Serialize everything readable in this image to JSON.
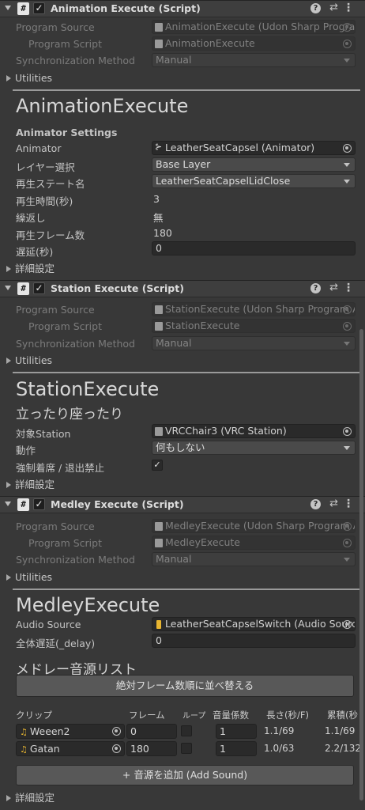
{
  "components": [
    {
      "title": "Animation Execute (Script)",
      "program_source_label": "Program Source",
      "program_source_value": "AnimationExecute (Udon Sharp Program Asset)",
      "program_script_label": "Program Script",
      "program_script_value": "AnimationExecute",
      "sync_label": "Synchronization Method",
      "sync_value": "Manual",
      "utilities": "Utilities",
      "heading": "AnimationExecute",
      "section": "Animator Settings",
      "animator_label": "Animator",
      "animator_value": "LeatherSeatCapsel (Animator)",
      "layer_label": "レイヤー選択",
      "layer_value": "Base Layer",
      "state_label": "再生ステート名",
      "state_value": "LeatherSeatCapselLidClose",
      "time_label": "再生時間(秒)",
      "time_value": "3",
      "loop_label": "繰返し",
      "loop_value": "無",
      "frames_label": "再生フレーム数",
      "frames_value": "180",
      "delay_label": "遅延(秒)",
      "delay_value": "0",
      "advanced": "詳細設定"
    },
    {
      "title": "Station Execute (Script)",
      "program_source_label": "Program Source",
      "program_source_value": "StationExecute (Udon Sharp Program Asset)",
      "program_script_label": "Program Script",
      "program_script_value": "StationExecute",
      "sync_label": "Synchronization Method",
      "sync_value": "Manual",
      "utilities": "Utilities",
      "heading": "StationExecute",
      "subheading": "立ったり座ったり",
      "station_label": "対象Station",
      "station_value": "VRCChair3 (VRC Station)",
      "action_label": "動作",
      "action_value": "何もしない",
      "force_label": "強制着席 / 退出禁止",
      "force_checked": true,
      "advanced": "詳細設定"
    },
    {
      "title": "Medley Execute (Script)",
      "program_source_label": "Program Source",
      "program_source_value": "MedleyExecute (Udon Sharp Program Asset)",
      "program_script_label": "Program Script",
      "program_script_value": "MedleyExecute",
      "sync_label": "Synchronization Method",
      "sync_value": "Manual",
      "utilities": "Utilities",
      "heading": "MedleyExecute",
      "audio_label": "Audio Source",
      "audio_value": "LeatherSeatCapselSwitch (Audio Source)",
      "delay_label": "全体遅延(_delay)",
      "delay_value": "0",
      "list_title": "メドレー音源リスト",
      "sort_button": "絶対フレーム数順に並べ替える",
      "columns": [
        "クリップ",
        "フレーム",
        "ループ",
        "音量係数",
        "長さ(秒/F)",
        "累積(秒"
      ],
      "rows": [
        {
          "clip": "Weeen2",
          "frame": "0",
          "loop": false,
          "volume": "1",
          "length": "1.1/69",
          "cumulative": "1.1/69"
        },
        {
          "clip": "Gatan",
          "frame": "180",
          "loop": false,
          "volume": "1",
          "length": "1.0/63",
          "cumulative": "2.2/132"
        }
      ],
      "add_button": "+ 音源を追加 (Add Sound)",
      "advanced": "詳細設定"
    }
  ]
}
